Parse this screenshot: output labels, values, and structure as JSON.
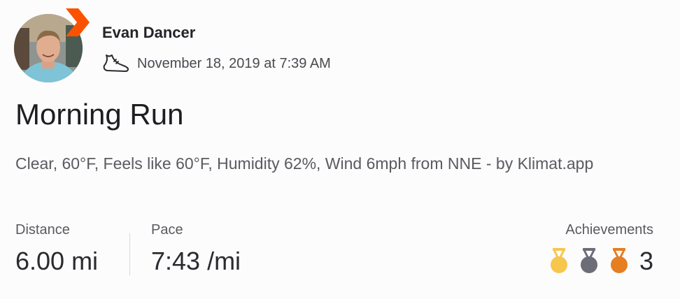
{
  "activity": {
    "athlete_name": "Evan Dancer",
    "timestamp": "November 18, 2019 at 7:39 AM",
    "sport_icon": "shoe-icon",
    "title": "Morning Run",
    "description": "Clear, 60°F, Feels like 60°F, Humidity 62%, Wind 6mph from NNE - by Klimat.app"
  },
  "stats": {
    "distance_label": "Distance",
    "distance_value": "6.00 mi",
    "pace_label": "Pace",
    "pace_value": "7:43 /mi"
  },
  "achievements": {
    "label": "Achievements",
    "count": "3",
    "medals": [
      "gold-medal-icon",
      "silver-medal-icon",
      "bronze-medal-icon"
    ]
  },
  "colors": {
    "brand_orange": "#fc5200",
    "gold": "#f7c64d",
    "silver": "#6d6d78",
    "bronze": "#e67e22"
  }
}
